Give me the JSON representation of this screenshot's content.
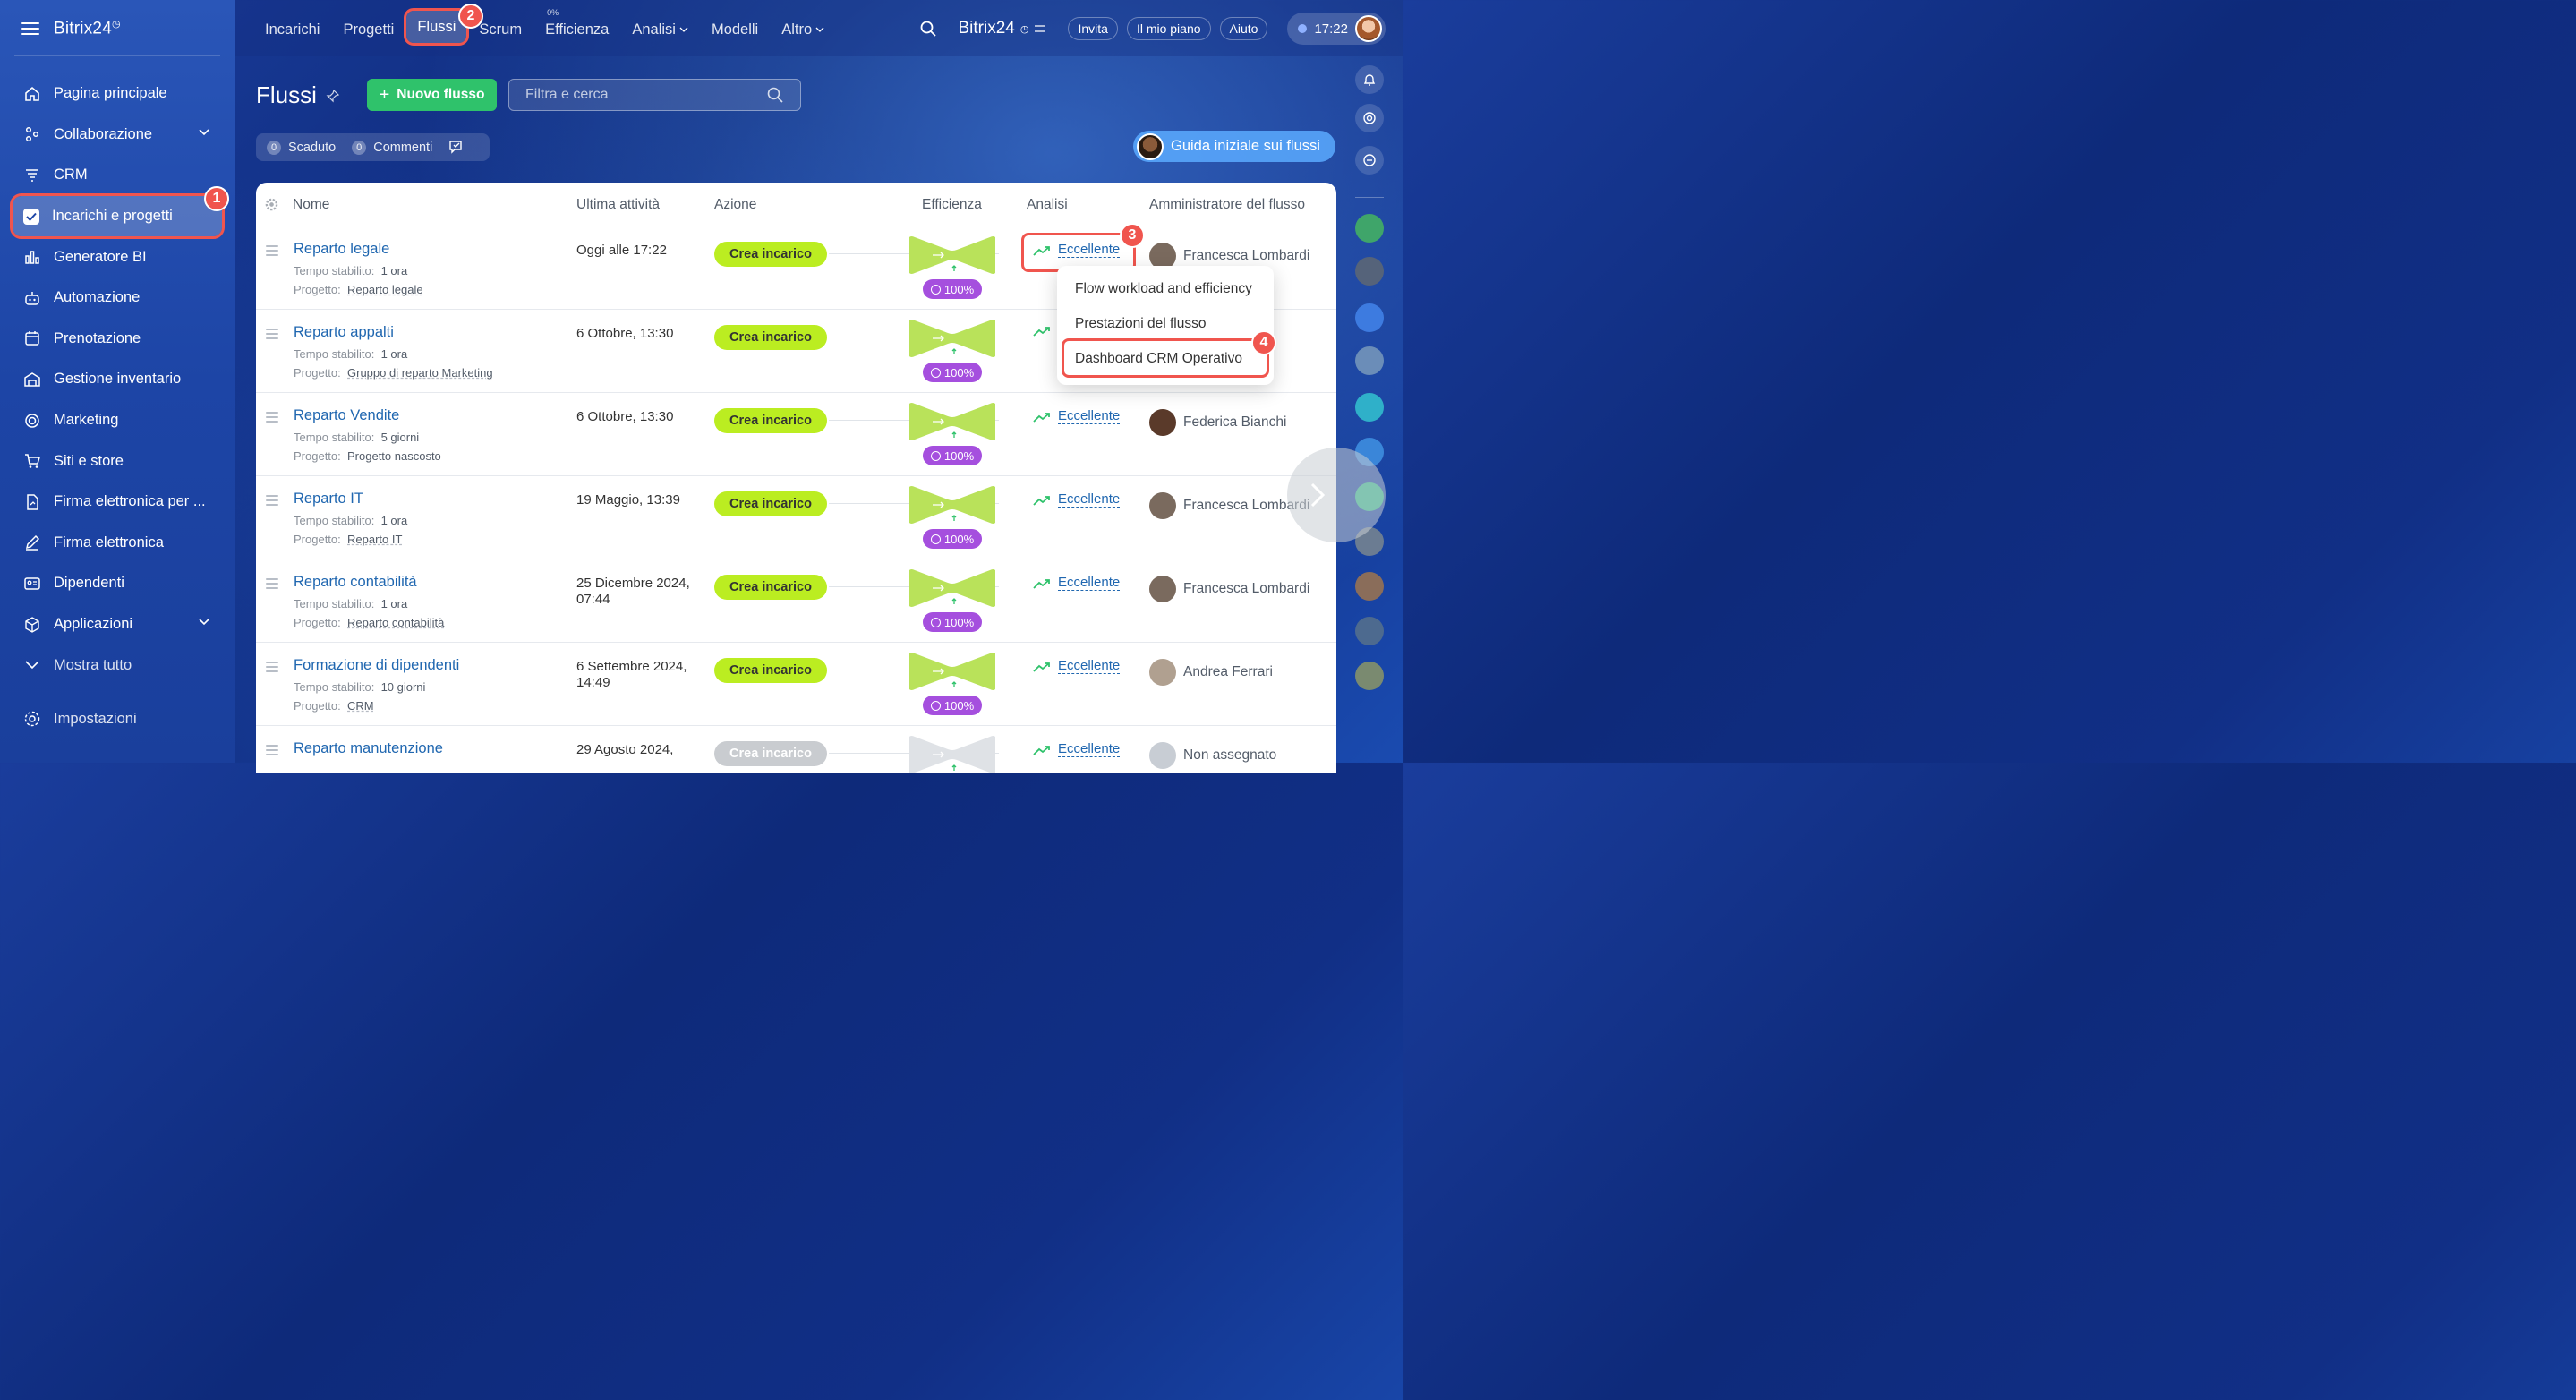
{
  "sidebar": {
    "brand": "Bitrix24",
    "items": [
      {
        "label": "Pagina principale",
        "icon": "home-icon"
      },
      {
        "label": "Collaborazione",
        "icon": "collab-icon"
      },
      {
        "label": "CRM",
        "icon": "crm-icon"
      },
      {
        "label": "Incarichi e progetti",
        "icon": "tasks-icon"
      },
      {
        "label": "Generatore BI",
        "icon": "chart-icon"
      },
      {
        "label": "Automazione",
        "icon": "robot-icon"
      },
      {
        "label": "Prenotazione",
        "icon": "calendar-icon"
      },
      {
        "label": "Gestione inventario",
        "icon": "warehouse-icon"
      },
      {
        "label": "Marketing",
        "icon": "target-icon"
      },
      {
        "label": "Siti e store",
        "icon": "cart-icon"
      },
      {
        "label": "Firma elettronica per ...",
        "icon": "doc-sign-icon"
      },
      {
        "label": "Firma elettronica",
        "icon": "pen-icon"
      },
      {
        "label": "Dipendenti",
        "icon": "id-card-icon"
      },
      {
        "label": "Applicazioni",
        "icon": "cube-icon"
      },
      {
        "label": "Mostra tutto",
        "icon": "chevron-down-icon"
      }
    ],
    "settings": "Impostazioni"
  },
  "steps": [
    "1",
    "2",
    "3",
    "4"
  ],
  "topnav": {
    "items": [
      "Incarichi",
      "Progetti",
      "Flussi",
      "Scrum",
      "Efficienza",
      "Analisi",
      "Modelli",
      "Altro"
    ],
    "efficiency_sup": "0%",
    "brand": "Bitrix24",
    "invite": "Invita",
    "plan": "Il mio piano",
    "help": "Aiuto",
    "time": "17:22"
  },
  "header": {
    "title": "Flussi",
    "new_button": "Nuovo flusso",
    "search_placeholder": "Filtra e cerca",
    "overdue_count": "0",
    "overdue_label": "Scaduto",
    "comments_count": "0",
    "comments_label": "Commenti",
    "guide": "Guida iniziale sui flussi"
  },
  "table": {
    "columns": [
      "Nome",
      "Ultima attività",
      "Azione",
      "Efficienza",
      "Analisi",
      "Amministratore del flusso"
    ],
    "time_label": "Tempo stabilito:",
    "project_label": "Progetto:",
    "action_label": "Crea incarico",
    "rows": [
      {
        "name": "Reparto legale",
        "time": "1 ora",
        "project": "Reparto legale",
        "activity": "Oggi alle 17:22",
        "efficiency": "100%",
        "analysis": "Eccellente",
        "admin": "Francesca Lombardi"
      },
      {
        "name": "Reparto appalti",
        "time": "1 ora",
        "project": "Gruppo di reparto Marketing",
        "activity": "6 Ottobre, 13:30",
        "efficiency": "100%",
        "analysis": "",
        "admin": "bardi"
      },
      {
        "name": "Reparto Vendite",
        "time": "5 giorni",
        "project": "Progetto nascosto",
        "activity": "6 Ottobre, 13:30",
        "efficiency": "100%",
        "analysis": "Eccellente",
        "admin": "Federica Bianchi"
      },
      {
        "name": "Reparto IT",
        "time": "1 ora",
        "project": "Reparto IT",
        "activity": "19 Maggio, 13:39",
        "efficiency": "100%",
        "analysis": "Eccellente",
        "admin": "Francesca Lombardi"
      },
      {
        "name": "Reparto contabilità",
        "time": "1 ora",
        "project": "Reparto contabilità",
        "activity": "25 Dicembre 2024, 07:44",
        "efficiency": "100%",
        "analysis": "Eccellente",
        "admin": "Francesca Lombardi"
      },
      {
        "name": "Formazione di dipendenti",
        "time": "10 giorni",
        "project": "CRM",
        "activity": "6 Settembre 2024, 14:49",
        "efficiency": "100%",
        "analysis": "Eccellente",
        "admin": "Andrea Ferrari"
      },
      {
        "name": "Reparto manutenzione",
        "time": "",
        "project": "",
        "activity": "29 Agosto 2024,",
        "efficiency": "",
        "analysis": "Eccellente",
        "admin": "Non assegnato"
      }
    ]
  },
  "popup": {
    "items": [
      "Flow workload and efficiency",
      "Prestazioni del flusso",
      "Dashboard CRM Operativo"
    ]
  },
  "colors": {
    "accent_green": "#2fc26b",
    "lime": "#bbed21",
    "highlight": "#f0554e",
    "purple": "#a54fde",
    "link": "#2067b0"
  }
}
